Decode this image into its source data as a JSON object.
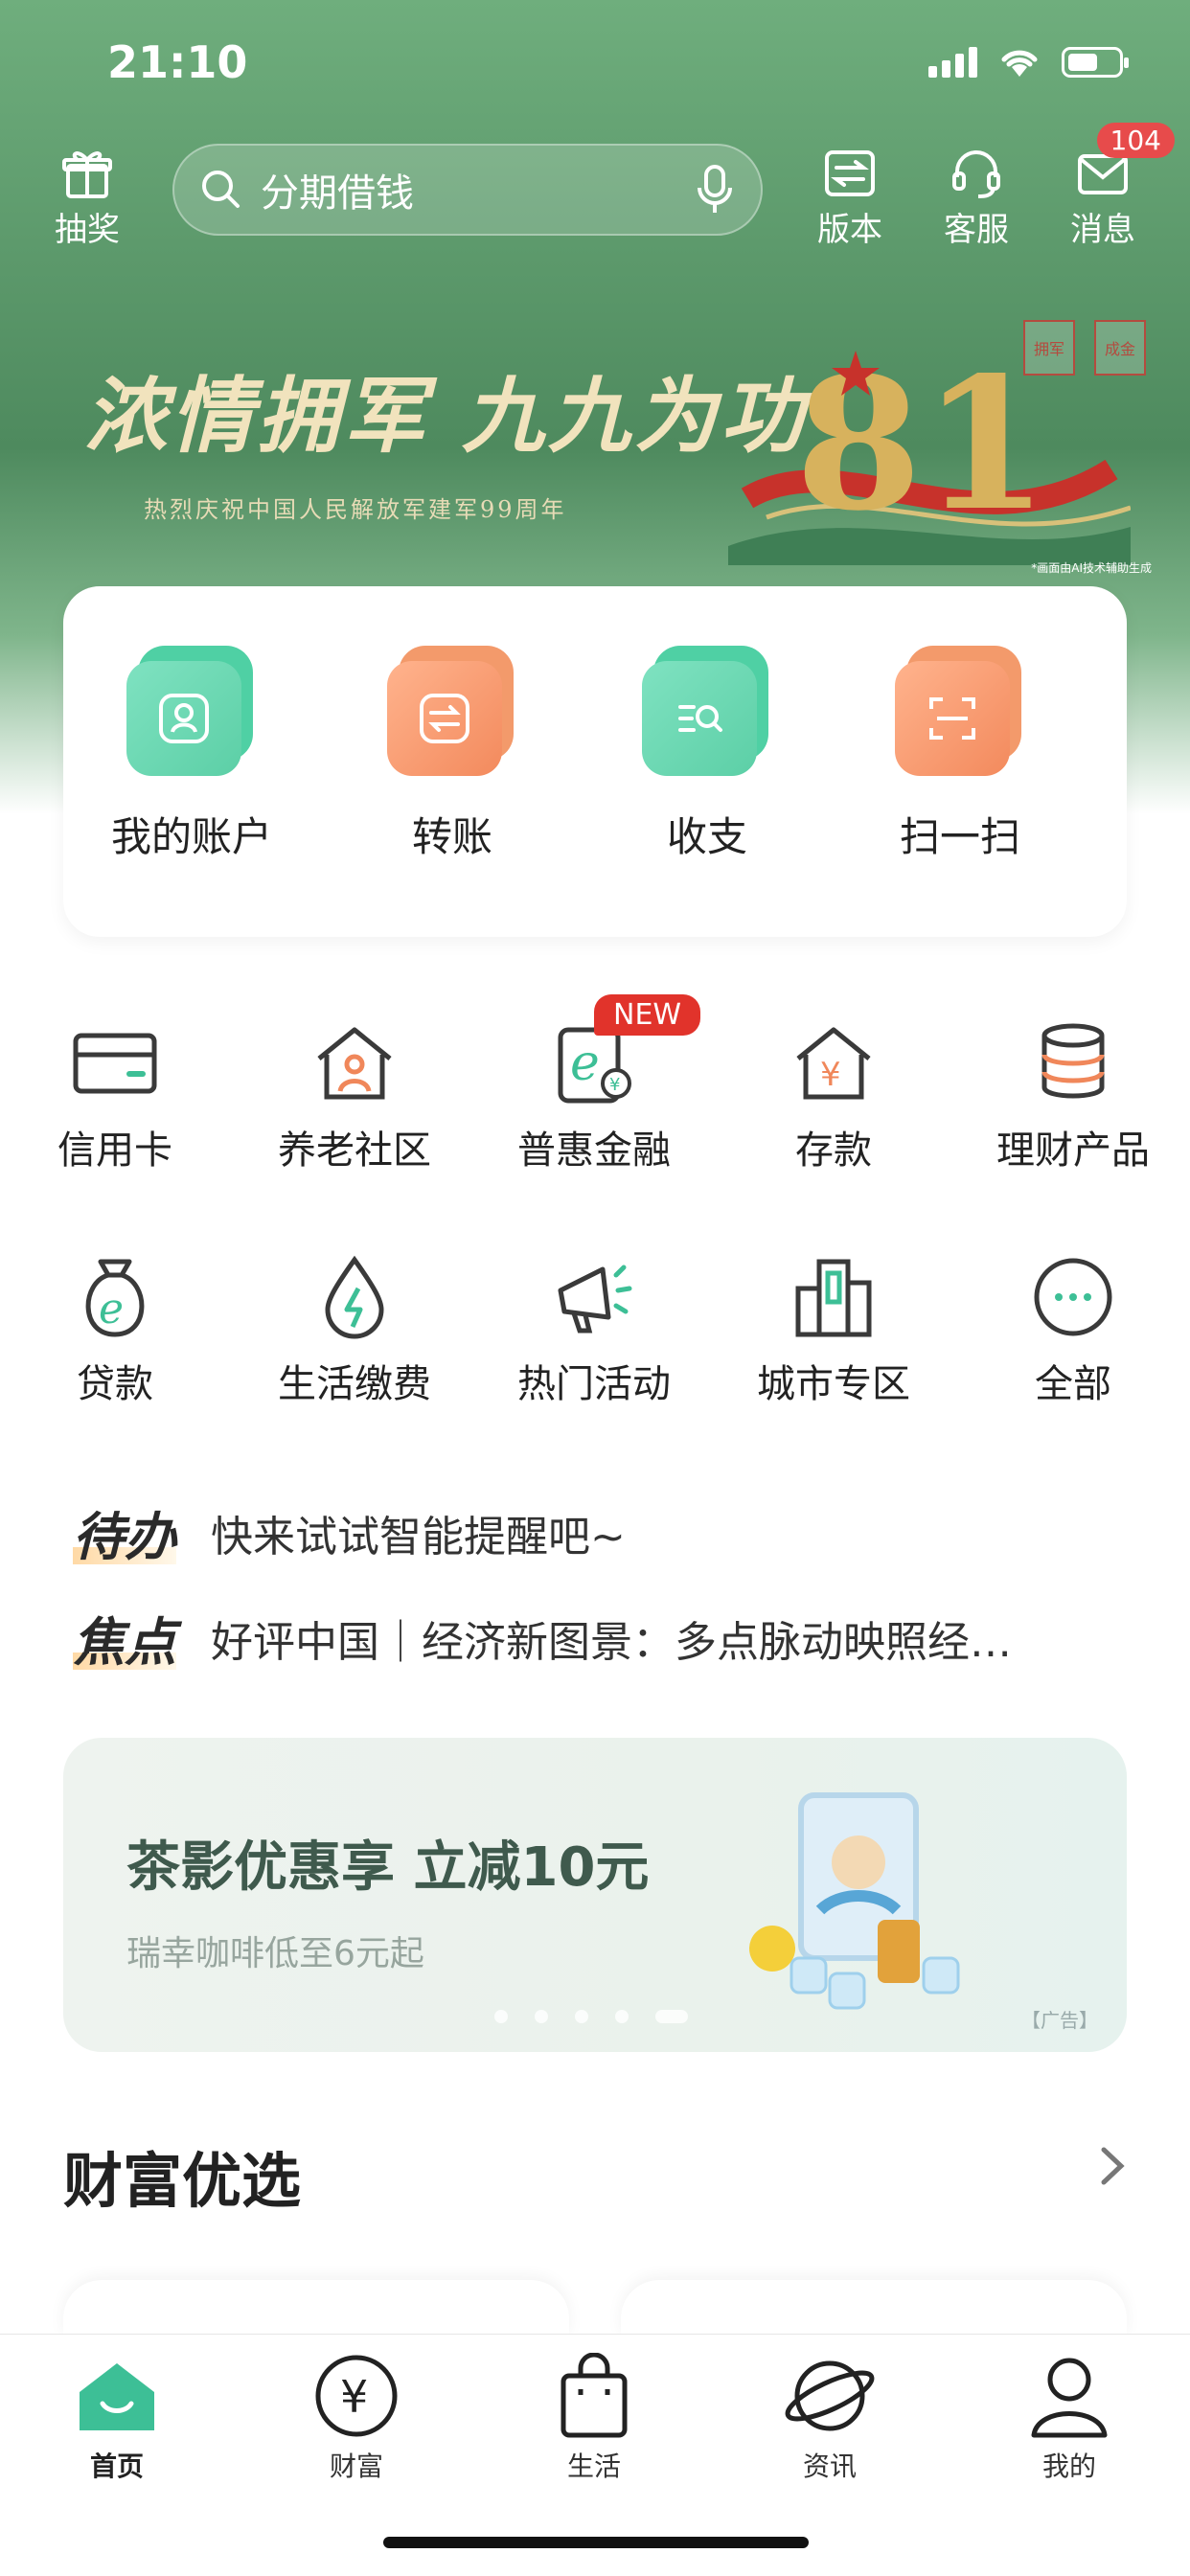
{
  "status": {
    "time": "21:10"
  },
  "header": {
    "lottery_label": "抽奖",
    "search_placeholder": "分期借钱",
    "version_label": "版本",
    "service_label": "客服",
    "message_label": "消息",
    "message_badge": "104"
  },
  "banner": {
    "title": "浓情拥军 九九为功",
    "subtitle": "热烈庆祝中国人民解放军建军99周年",
    "note": "*画面由AI技术辅助生成",
    "seal_left": "拥军",
    "seal_right": "成金",
    "number": "81"
  },
  "quick_actions": [
    {
      "label": "我的账户",
      "icon": "account-icon"
    },
    {
      "label": "转账",
      "icon": "transfer-icon"
    },
    {
      "label": "收支",
      "icon": "income-expense-icon"
    },
    {
      "label": "扫一扫",
      "icon": "scan-icon"
    }
  ],
  "grid": [
    {
      "label": "信用卡",
      "icon": "credit-card-icon"
    },
    {
      "label": "养老社区",
      "icon": "elderly-community-icon"
    },
    {
      "label": "普惠金融",
      "icon": "inclusive-finance-icon"
    },
    {
      "label": "存款",
      "icon": "deposit-icon"
    },
    {
      "label": "理财产品",
      "icon": "wealth-product-icon"
    },
    {
      "label": "贷款",
      "icon": "loan-icon"
    },
    {
      "label": "生活缴费",
      "icon": "utility-payment-icon"
    },
    {
      "label": "热门活动",
      "icon": "hot-activity-icon"
    },
    {
      "label": "城市专区",
      "icon": "city-zone-icon"
    },
    {
      "label": "全部",
      "icon": "more-icon"
    }
  ],
  "new_badge": "NEW",
  "todo": {
    "tag": "待办",
    "text": "快来试试智能提醒吧~"
  },
  "focus": {
    "tag": "焦点",
    "text": "好评中国｜经济新图景：多点脉动映照经…"
  },
  "ad": {
    "title": "茶影优惠享 立减10元",
    "subtitle": "瑞幸咖啡低至6元起",
    "tag": "【广告】",
    "page_count": 5,
    "active_page": 5
  },
  "wealth": {
    "title": "财富优选"
  },
  "tabbar": [
    {
      "label": "首页",
      "icon": "home-icon",
      "active": true
    },
    {
      "label": "财富",
      "icon": "yuan-icon",
      "active": false
    },
    {
      "label": "生活",
      "icon": "shopping-bag-icon",
      "active": false
    },
    {
      "label": "资讯",
      "icon": "planet-icon",
      "active": false
    },
    {
      "label": "我的",
      "icon": "user-icon",
      "active": false
    }
  ],
  "colors": {
    "brand_green": "#3dbf96",
    "accent_orange": "#f0875a",
    "badge_red": "#e74b4b"
  }
}
